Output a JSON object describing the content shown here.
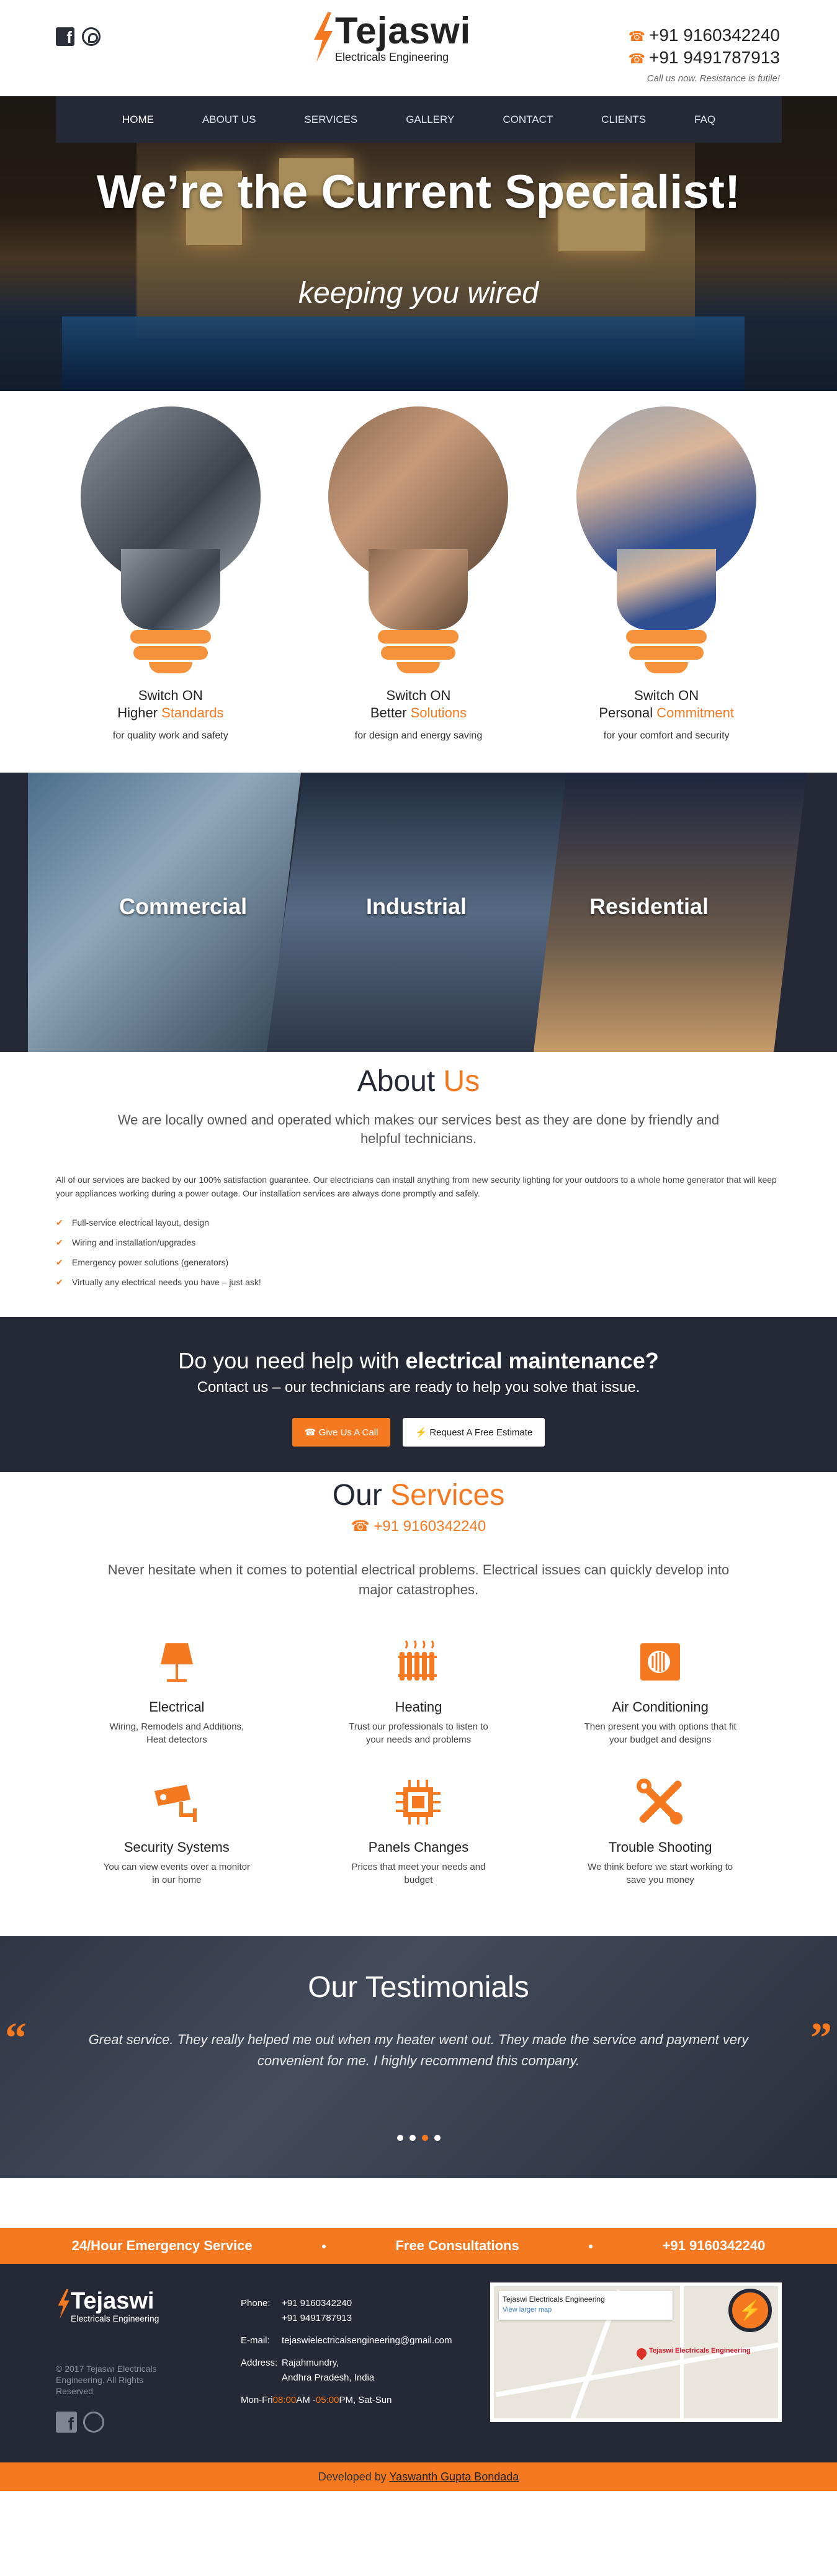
{
  "header": {
    "brand": "Tejaswi",
    "subtitle": "Electricals Engineering",
    "phones": [
      "+91 9160342240",
      "+91 9491787913"
    ],
    "tagline": "Call us now. Resistance is futile!"
  },
  "nav": [
    "HOME",
    "ABOUT US",
    "SERVICES",
    "GALLERY",
    "CONTACT",
    "CLIENTS",
    "FAQ"
  ],
  "hero": {
    "title": "We’re the Current Specialist!",
    "subtitle": "keeping you wired"
  },
  "bulbs": [
    {
      "line1": "Switch ON",
      "line2a": "Higher ",
      "line2b": "Standards",
      "desc": "for quality work and safety"
    },
    {
      "line1": "Switch ON",
      "line2a": "Better ",
      "line2b": "Solutions",
      "desc": "for design and energy saving"
    },
    {
      "line1": "Switch ON",
      "line2a": "Personal ",
      "line2b": "Commitment",
      "desc": "for your comfort and security"
    }
  ],
  "sectors": [
    "Commercial",
    "Industrial",
    "Residential"
  ],
  "about": {
    "title_a": "About ",
    "title_b": "Us",
    "lead": "We are locally owned and operated which makes our services best as they are done by friendly and helpful technicians.",
    "body": "All of our services are backed by our 100% satisfaction guarantee. Our electricians can install anything from new security lighting for your outdoors to a whole home generator that will keep your appliances working during a power outage. Our installation services are always done promptly and safely.",
    "list": [
      "Full-service electrical layout, design",
      "Wiring and installation/upgrades",
      "Emergency power solutions (generators)",
      "Virtually any electrical needs you have – just ask!"
    ]
  },
  "help": {
    "title_a": "Do you need help with ",
    "title_b": "electrical maintenance?",
    "sub": "Contact us – our technicians are ready to help you solve that issue.",
    "btn_call": "Give Us A Call",
    "btn_estimate": "Request A Free Estimate"
  },
  "services": {
    "title_a": "Our ",
    "title_b": "Services",
    "phone": "+91 9160342240",
    "lead": "Never hesitate when it comes to potential electrical problems. Electrical issues can quickly develop into major catastrophes.",
    "items": [
      {
        "name": "Electrical",
        "desc": "Wiring, Remodels and Additions, Heat detectors",
        "icon": "lamp-icon"
      },
      {
        "name": "Heating",
        "desc": "Trust our professionals to listen to your needs and problems",
        "icon": "heater-icon"
      },
      {
        "name": "Air Conditioning",
        "desc": "Then present you with options that fit your budget and designs",
        "icon": "ac-icon"
      },
      {
        "name": "Security Systems",
        "desc": "You can view events over a monitor in our home",
        "icon": "camera-icon"
      },
      {
        "name": "Panels Changes",
        "desc": "Prices that meet your needs and budget",
        "icon": "chip-icon"
      },
      {
        "name": "Trouble Shooting",
        "desc": "We think before we start working to save you money",
        "icon": "tools-icon"
      }
    ]
  },
  "testimonials": {
    "title": "Our Testimonials",
    "quote": "Great service. They really helped me out when my heater went out. They made the service and payment very convenient for me. I highly recommend this company."
  },
  "strip": [
    "24/Hour Emergency Service",
    "Free Consultations",
    "+91 9160342240"
  ],
  "footer": {
    "copyright": "© 2017 Tejaswi Electricals Engineering. All Rights Reserved",
    "phone_label": "Phone:",
    "phones": [
      "+91 9160342240",
      "+91 9491787913"
    ],
    "email_label": "E-mail:",
    "email": "tejaswielectricalsengineering@gmail.com",
    "address_label": "Address:",
    "address": [
      "Rajahmundry,",
      "Andhra Pradesh, India"
    ],
    "hours_a": "Mon-Fri ",
    "hours_b": "08:00",
    "hours_c": " AM - ",
    "hours_d": "05:00",
    "hours_e": " PM, Sat-Sun",
    "map_title": "Tejaswi Electricals Engineering",
    "map_link": "View larger map",
    "map_pin": "Tejaswi Electricals Engineering"
  },
  "bottom": {
    "prefix": "Developed by ",
    "name": "Yaswanth Gupta Bondada"
  },
  "colors": {
    "accent": "#f47920",
    "dark": "#252936"
  }
}
